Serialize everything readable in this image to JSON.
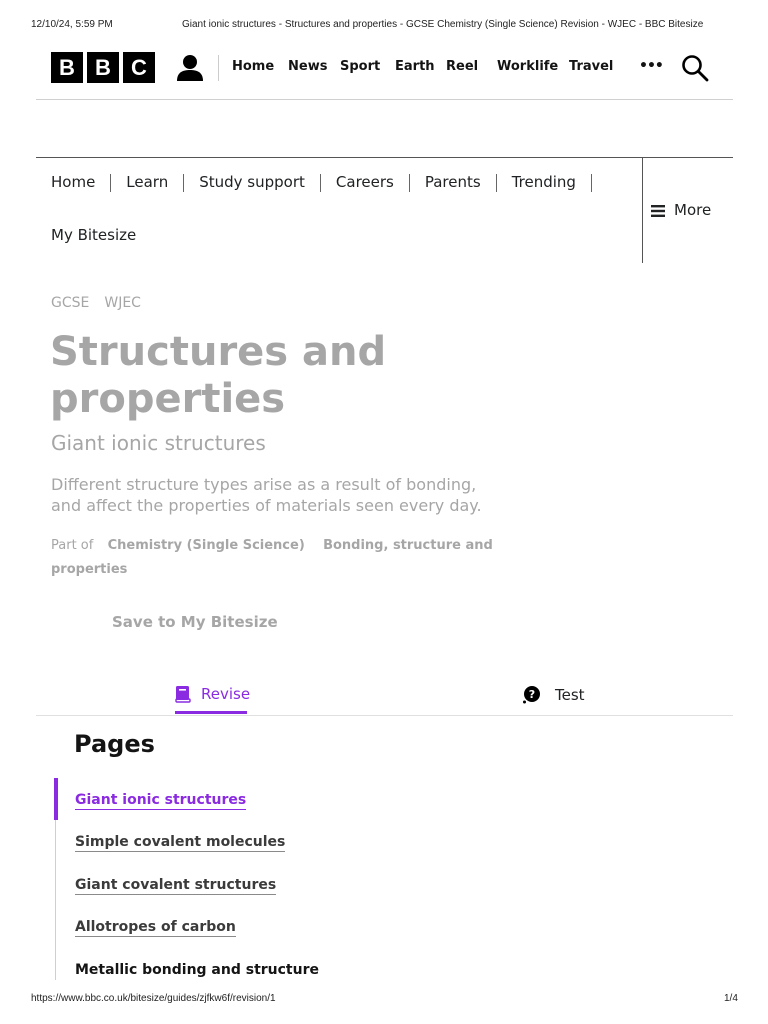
{
  "browser": {
    "datetime": "12/10/24, 5:59 PM",
    "page_title": "Giant ionic structures - Structures and properties - GCSE Chemistry (Single Science) Revision - WJEC - BBC Bitesize",
    "url": "https://www.bbc.co.uk/bitesize/guides/zjfkw6f/revision/1",
    "page_count": "1/4"
  },
  "header": {
    "logo_letters": [
      "B",
      "B",
      "C"
    ],
    "nav": [
      "Home",
      "News",
      "Sport",
      "Earth",
      "Reel",
      "Worklife",
      "Travel"
    ],
    "more_glyph": "•••"
  },
  "bitesize_nav": {
    "items": [
      "Home",
      "Learn",
      "Study support",
      "Careers",
      "Parents",
      "Trending",
      "My Bitesize"
    ],
    "more_label": "More"
  },
  "breadcrumb": [
    "GCSE",
    "WJEC"
  ],
  "hero": {
    "title_line1": "Structures and",
    "title_line2": "properties",
    "subtitle": "Giant ionic structures",
    "description_line1": "Different structure types arise as a result of bonding,",
    "description_line2": "and affect the properties of materials seen every day.",
    "part_of_label": "Part of",
    "part_of_link1": "Chemistry (Single Science)",
    "part_of_link2_line1": "Bonding, structure and",
    "part_of_link2_line2": "properties",
    "save_label": "Save to My Bitesize"
  },
  "tabs": {
    "revise": "Revise",
    "test": "Test",
    "active_color": "#8a2be2"
  },
  "pages": {
    "heading": "Pages",
    "items": [
      "Giant ionic structures",
      "Simple covalent molecules",
      "Giant covalent structures",
      "Allotropes of carbon",
      "Metallic bonding and structure"
    ]
  }
}
